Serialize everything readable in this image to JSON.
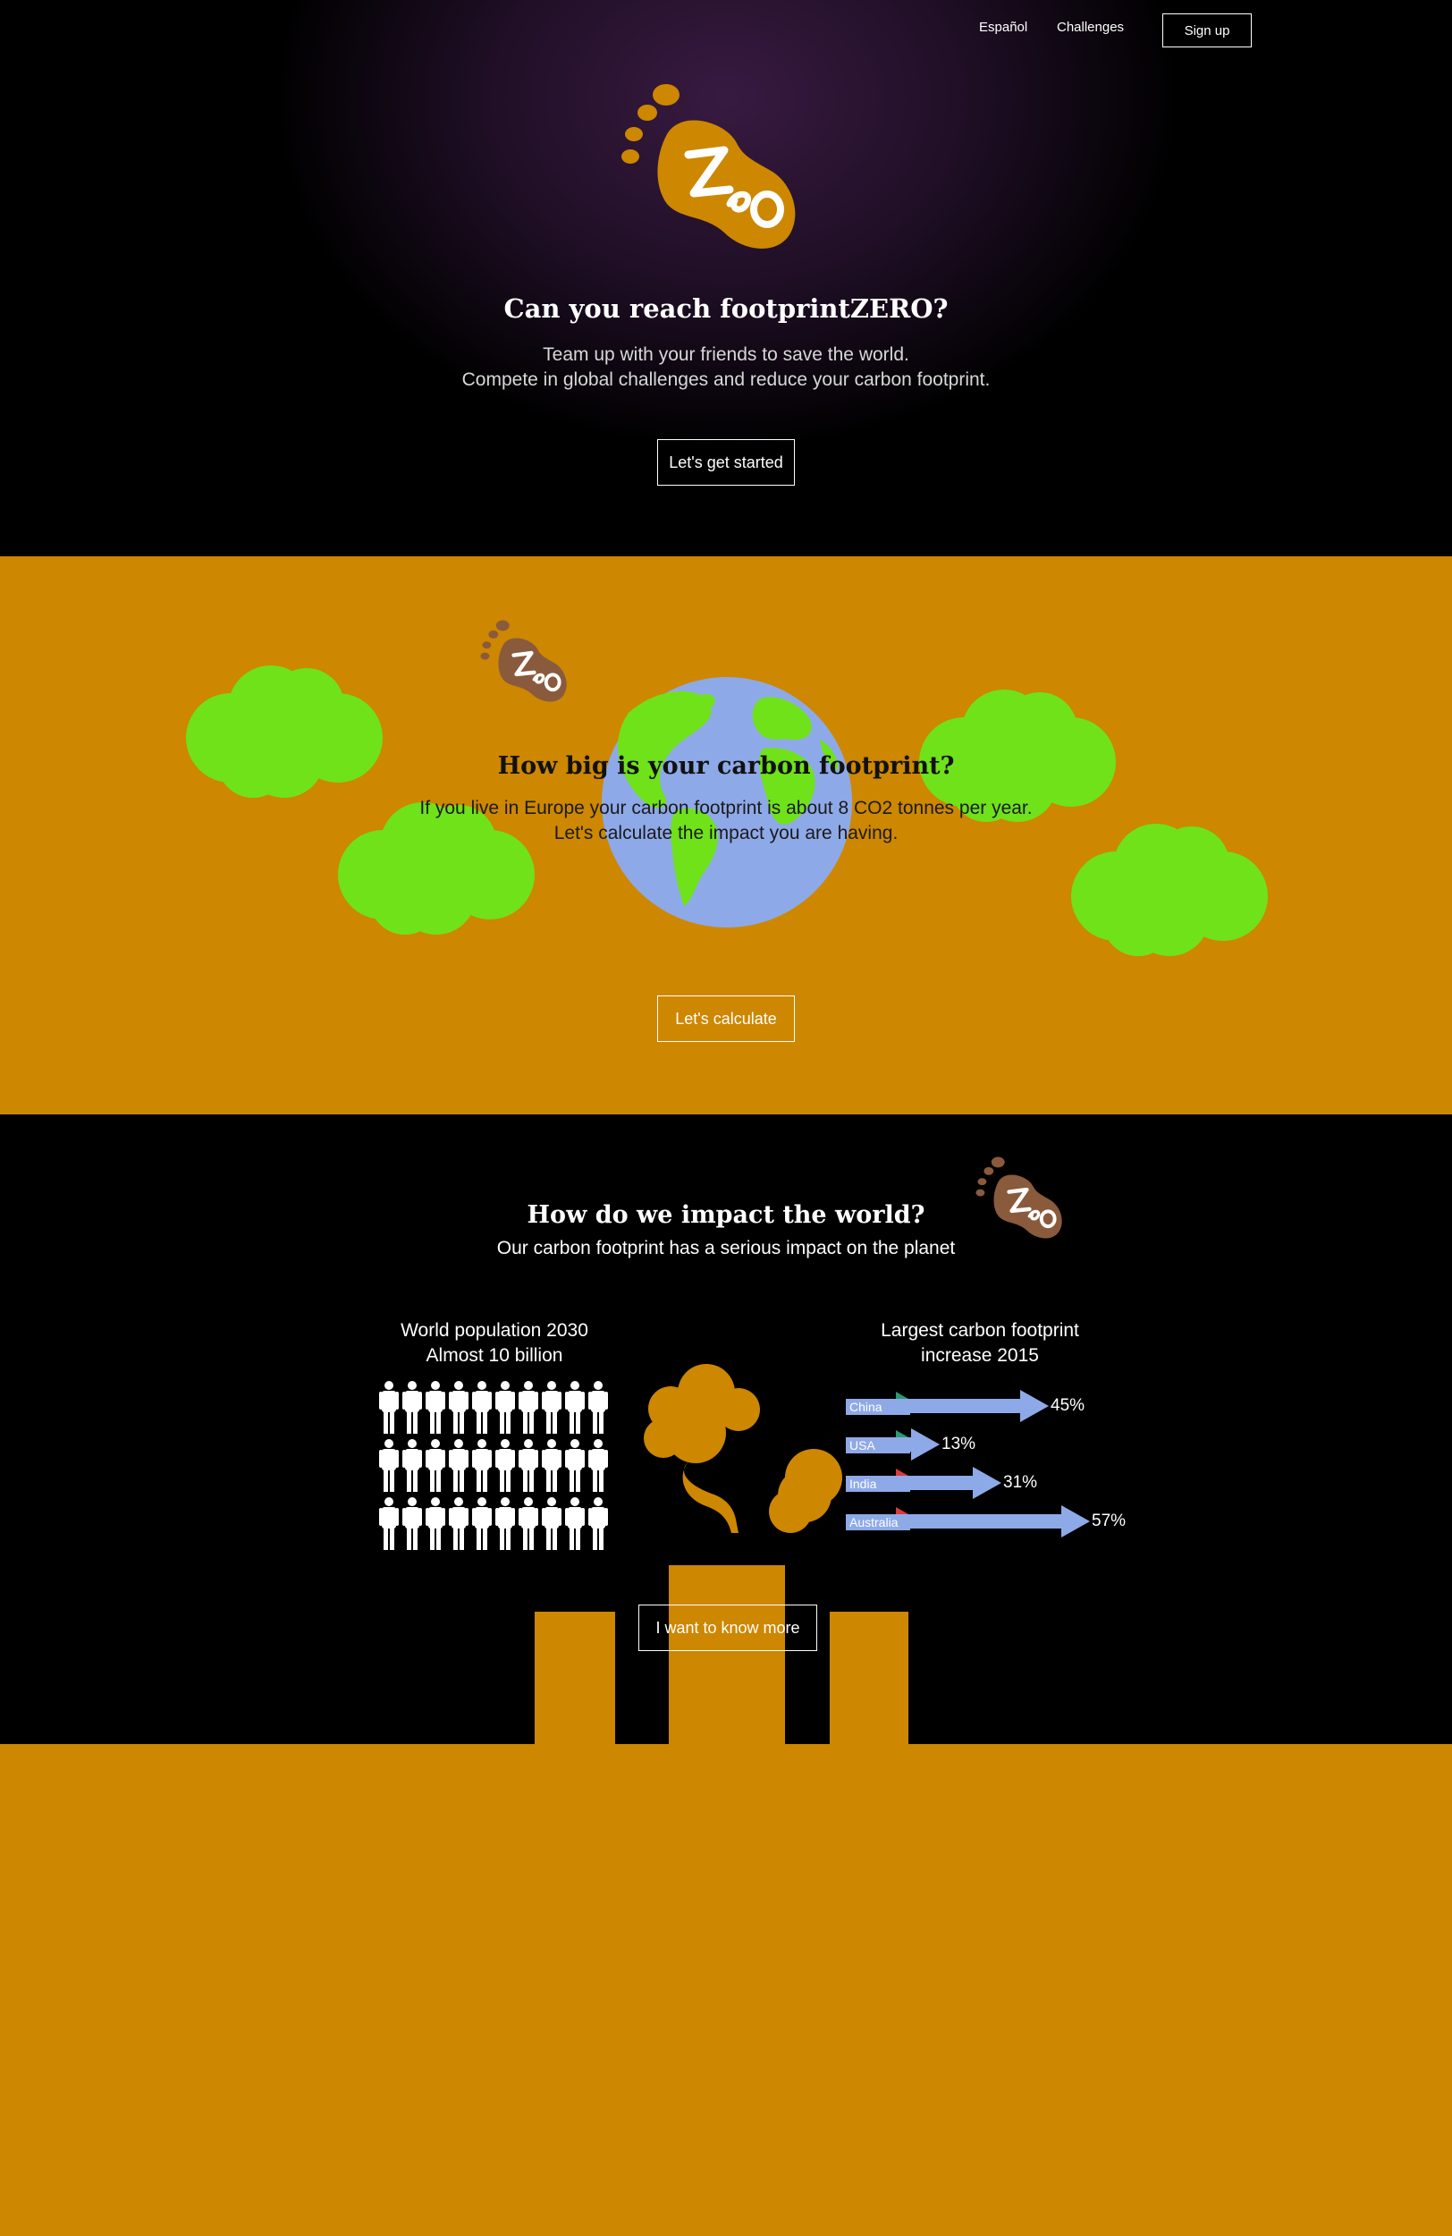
{
  "nav": {
    "lang": "Español",
    "challenges": "Challenges",
    "signup": "Sign up"
  },
  "hero": {
    "title": "Can you reach footprintZERO?",
    "line1": "Team up with your friends to save the world.",
    "line2": "Compete in global challenges and reduce your carbon footprint.",
    "cta": "Let's get started"
  },
  "calc": {
    "title": "How big is your carbon footprint?",
    "line1": "If you live in Europe your carbon footprint is about 8 CO2 tonnes per year.",
    "line2": "Let's calculate the impact you are having.",
    "cta": "Let's calculate"
  },
  "impact": {
    "title": "How do we impact the world?",
    "subtitle": "Our carbon footprint has a serious impact on the planet",
    "population_line1": "World population 2030",
    "population_line2": "Almost 10 billion",
    "increase_line1": "Largest carbon footprint",
    "increase_line2": "increase 2015",
    "cta": "I want to know more"
  },
  "chart_data": {
    "type": "bar",
    "title": "Largest carbon footprint increase 2015",
    "categories": [
      "China",
      "USA",
      "India",
      "Australia"
    ],
    "values": [
      45,
      13,
      31,
      57
    ],
    "value_labels": [
      "45%",
      "13%",
      "31%",
      "57%"
    ]
  },
  "colors": {
    "orange": "#cd8700",
    "cloud": "#6fe21a",
    "globe_ocean": "#8ea9e8",
    "land": "#6fe21a",
    "arrow": "#8ea9e8",
    "logo_brown": "#8a5a3c"
  },
  "icons": [
    "footprint-logo",
    "person-icon",
    "globe",
    "cloud",
    "factory",
    "smoke"
  ]
}
